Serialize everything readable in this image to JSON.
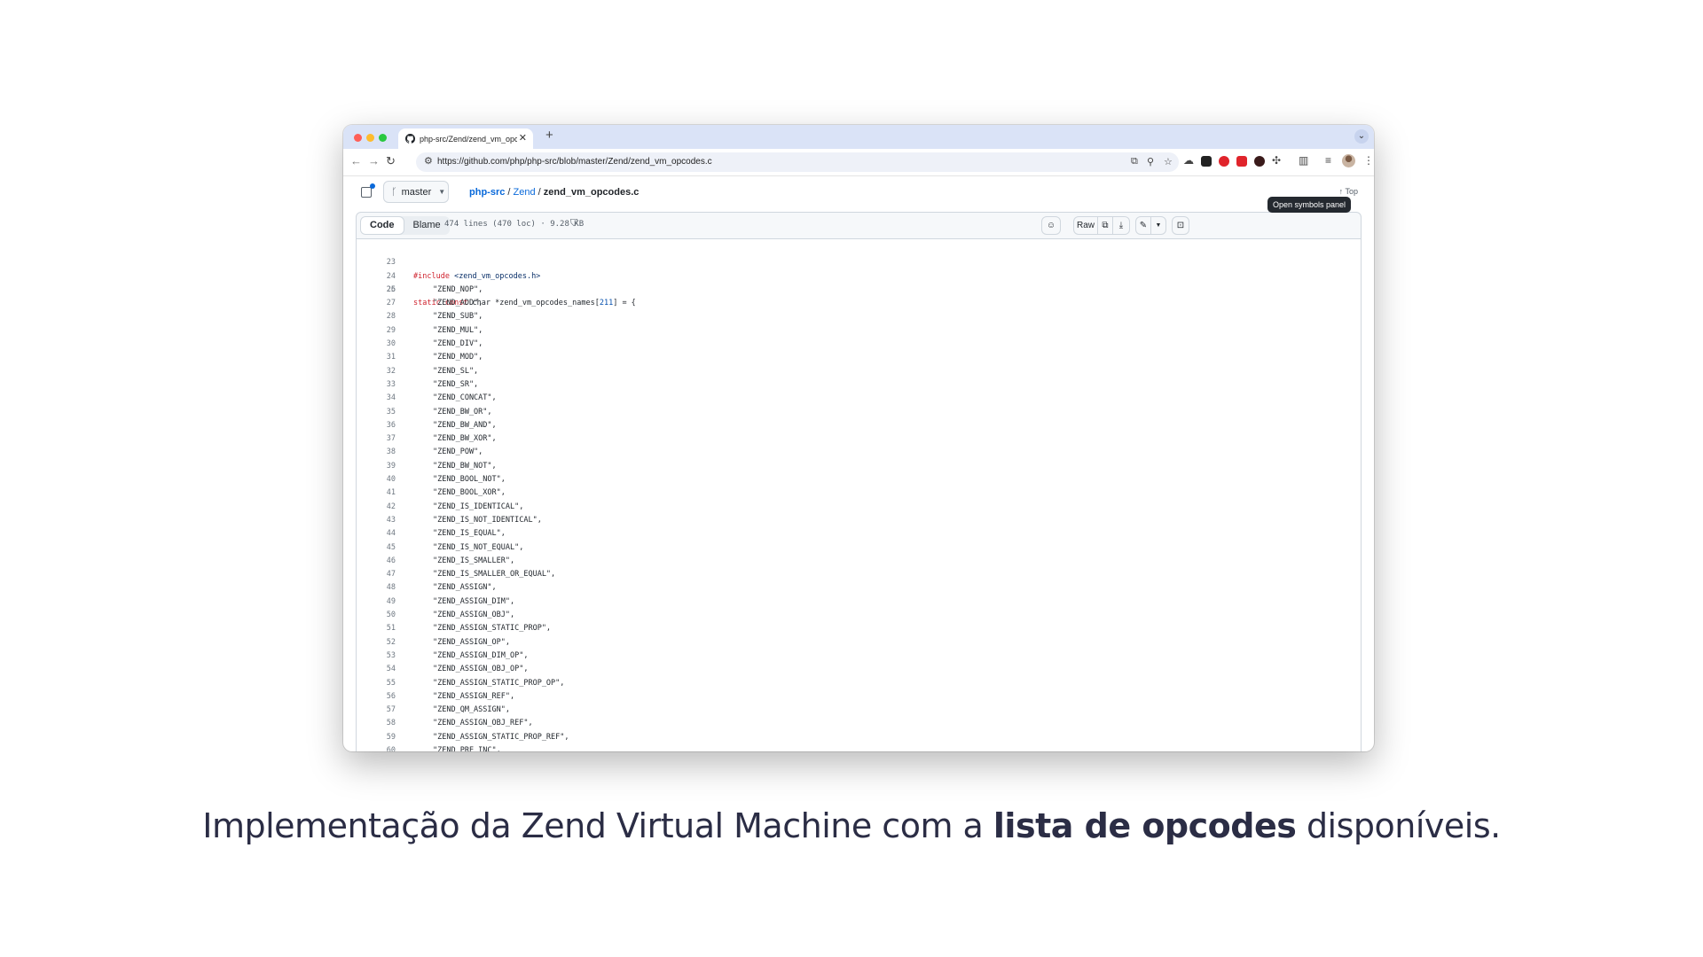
{
  "browser": {
    "tab_title": "php-src/Zend/zend_vm_opcodes.c at master · php/php-src",
    "new_tab_symbol": "+",
    "tab_close_symbol": "✕",
    "tab_menu_symbol": "⌄",
    "url": "https://github.com/php/php-src/blob/master/Zend/zend_vm_opcodes.c",
    "traffic_lights": {
      "close": "#ff5f57",
      "minimize": "#febc2e",
      "maximize": "#28c840"
    }
  },
  "github": {
    "branch": "master",
    "breadcrumb": {
      "repo": "php-src",
      "dir": "Zend",
      "file": "zend_vm_opcodes.c",
      "sep": "/"
    },
    "top_link": "Top",
    "tooltip": "Open symbols panel",
    "tabs": {
      "code": "Code",
      "blame": "Blame"
    },
    "file_meta": "474 lines (470 loc) · 9.28 KB",
    "raw_label": "Raw"
  },
  "code": {
    "include_line": {
      "n": "23",
      "directive": "#include",
      "path": " <zend_vm_opcodes.h>"
    },
    "blank_line": {
      "n": "24"
    },
    "decl_line": {
      "n": "25",
      "kw1": "static",
      "kw2": "const",
      "rest1": " char *zend_vm_opcodes_names[",
      "size": "211",
      "rest2": "] = {"
    },
    "entries": [
      {
        "n": "26",
        "text": "\"ZEND_NOP\","
      },
      {
        "n": "27",
        "text": "\"ZEND_ADD\","
      },
      {
        "n": "28",
        "text": "\"ZEND_SUB\","
      },
      {
        "n": "29",
        "text": "\"ZEND_MUL\","
      },
      {
        "n": "30",
        "text": "\"ZEND_DIV\","
      },
      {
        "n": "31",
        "text": "\"ZEND_MOD\","
      },
      {
        "n": "32",
        "text": "\"ZEND_SL\","
      },
      {
        "n": "33",
        "text": "\"ZEND_SR\","
      },
      {
        "n": "34",
        "text": "\"ZEND_CONCAT\","
      },
      {
        "n": "35",
        "text": "\"ZEND_BW_OR\","
      },
      {
        "n": "36",
        "text": "\"ZEND_BW_AND\","
      },
      {
        "n": "37",
        "text": "\"ZEND_BW_XOR\","
      },
      {
        "n": "38",
        "text": "\"ZEND_POW\","
      },
      {
        "n": "39",
        "text": "\"ZEND_BW_NOT\","
      },
      {
        "n": "40",
        "text": "\"ZEND_BOOL_NOT\","
      },
      {
        "n": "41",
        "text": "\"ZEND_BOOL_XOR\","
      },
      {
        "n": "42",
        "text": "\"ZEND_IS_IDENTICAL\","
      },
      {
        "n": "43",
        "text": "\"ZEND_IS_NOT_IDENTICAL\","
      },
      {
        "n": "44",
        "text": "\"ZEND_IS_EQUAL\","
      },
      {
        "n": "45",
        "text": "\"ZEND_IS_NOT_EQUAL\","
      },
      {
        "n": "46",
        "text": "\"ZEND_IS_SMALLER\","
      },
      {
        "n": "47",
        "text": "\"ZEND_IS_SMALLER_OR_EQUAL\","
      },
      {
        "n": "48",
        "text": "\"ZEND_ASSIGN\","
      },
      {
        "n": "49",
        "text": "\"ZEND_ASSIGN_DIM\","
      },
      {
        "n": "50",
        "text": "\"ZEND_ASSIGN_OBJ\","
      },
      {
        "n": "51",
        "text": "\"ZEND_ASSIGN_STATIC_PROP\","
      },
      {
        "n": "52",
        "text": "\"ZEND_ASSIGN_OP\","
      },
      {
        "n": "53",
        "text": "\"ZEND_ASSIGN_DIM_OP\","
      },
      {
        "n": "54",
        "text": "\"ZEND_ASSIGN_OBJ_OP\","
      },
      {
        "n": "55",
        "text": "\"ZEND_ASSIGN_STATIC_PROP_OP\","
      },
      {
        "n": "56",
        "text": "\"ZEND_ASSIGN_REF\","
      },
      {
        "n": "57",
        "text": "\"ZEND_QM_ASSIGN\","
      },
      {
        "n": "58",
        "text": "\"ZEND_ASSIGN_OBJ_REF\","
      },
      {
        "n": "59",
        "text": "\"ZEND_ASSIGN_STATIC_PROP_REF\","
      },
      {
        "n": "60",
        "text": "\"ZEND_PRE_INC\","
      }
    ]
  },
  "caption": {
    "part1": "Implementação da Zend Virtual Machine com a ",
    "bold": "lista de opcodes",
    "part2": " disponíveis."
  },
  "colors": {
    "link": "#0969da",
    "caption_text": "#2b2d45",
    "keyword": "#cf222e",
    "number": "#0550ae",
    "string": "#0a3069",
    "tab_strip": "#dae3f7"
  },
  "icons": {
    "back": "arrow-left-icon",
    "forward": "arrow-right-icon",
    "reload": "reload-icon",
    "branch": "git-branch-icon",
    "shield": "shield-icon",
    "copilot": "copilot-icon",
    "copy": "copy-icon",
    "download": "download-icon",
    "edit": "pencil-icon",
    "symbols": "symbols-icon"
  }
}
